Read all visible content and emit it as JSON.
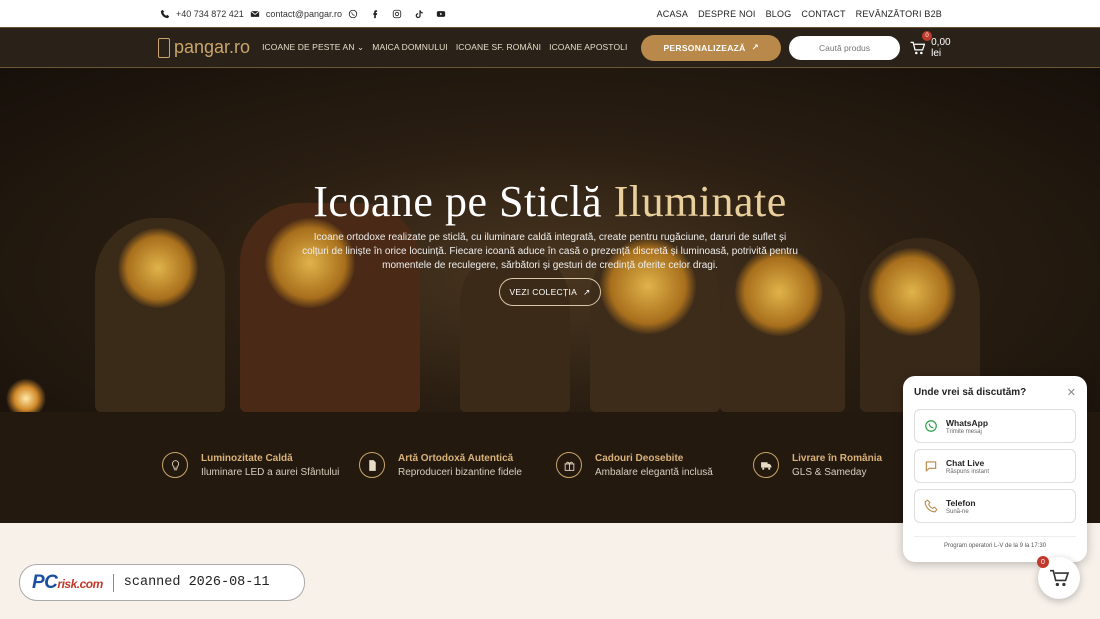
{
  "topbar": {
    "phone": "+40 734 872 421",
    "email": "contact@pangar.ro",
    "links": [
      "ACASA",
      "DESPRE NOI",
      "BLOG",
      "CONTACT",
      "REVÂNZĂTORI B2B"
    ]
  },
  "header": {
    "logo_text": "pangar.ro",
    "nav": [
      "ICOANE DE PESTE AN",
      "MAICA DOMNULUI",
      "ICOANE SF. ROMÂNI",
      "ICOANE APOSTOLI"
    ],
    "personalize_label": "PERSONALIZEAZĂ",
    "search_placeholder": "Caută produs",
    "cart_count": "0",
    "cart_total": "0,00 lei"
  },
  "hero": {
    "title_main": "Icoane pe Sticlă",
    "title_accent": "Iluminate",
    "description": "Icoane ortodoxe realizate pe sticlă, cu iluminare caldă integrată, create pentru rugăciune, daruri de suflet și colțuri de liniște în orice locuință. Fiecare icoană aduce în casă o prezență discretă și luminoasă, potrivită pentru momentele de reculegere, sărbători și gesturi de credință oferite celor dragi.",
    "cta_label": "VEZI COLECȚIA"
  },
  "features": [
    {
      "title": "Luminozitate Caldă",
      "subtitle": "Iluminare LED a aurei Sfântului",
      "icon": "lightbulb-icon"
    },
    {
      "title": "Artă Ortodoxă Autentică",
      "subtitle": "Reproduceri bizantine fidele",
      "icon": "document-icon"
    },
    {
      "title": "Cadouri Deosebite",
      "subtitle": "Ambalare elegantă inclusă",
      "icon": "gift-icon"
    },
    {
      "title": "Livrare în România",
      "subtitle": "GLS & Sameday",
      "icon": "truck-icon"
    }
  ],
  "chat": {
    "title": "Unde vrei să discutăm?",
    "options": [
      {
        "title": "WhatsApp",
        "subtitle": "Trimite mesaj"
      },
      {
        "title": "Chat Live",
        "subtitle": "Răspuns instant"
      },
      {
        "title": "Telefon",
        "subtitle": "Sună-ne"
      }
    ],
    "footer": "Program operatori L-V de la 9 la 17:30"
  },
  "floating_cart": {
    "count": "0"
  },
  "watermark": {
    "brand": "PC",
    "brand_suffix": "risk.com",
    "scanned": "scanned 2026-08-11"
  },
  "colors": {
    "header_bg": "#2a2219",
    "accent_gold": "#b8894a",
    "feature_title": "#d9b27a",
    "features_bg": "#24190f"
  }
}
